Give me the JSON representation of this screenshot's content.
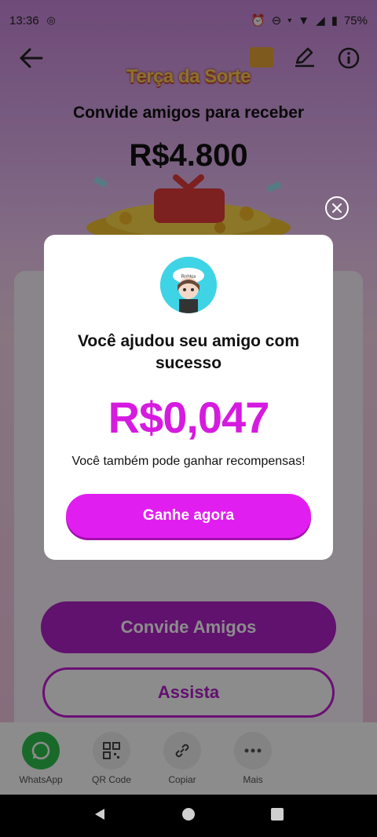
{
  "status_bar": {
    "time": "13:36",
    "battery": "75%"
  },
  "header": {
    "brand_title": "Terça da Sorte",
    "headline": "Convide amigos para receber",
    "big_amount": "R$4.800"
  },
  "main": {
    "invite_button_label": "Convide Amigos",
    "watch_button_label": "Assista"
  },
  "share_bar": {
    "items": [
      {
        "label": "WhatsApp",
        "icon": "whatsapp-icon"
      },
      {
        "label": "QR Code",
        "icon": "qr-code-icon"
      },
      {
        "label": "Copiar",
        "icon": "link-icon"
      },
      {
        "label": "Mais",
        "icon": "more-icon"
      }
    ]
  },
  "modal": {
    "title": "Você ajudou seu amigo com sucesso",
    "amount": "R$0,047",
    "subtitle": "Você também pode ganhar recompensas!",
    "button_label": "Ganhe agora",
    "avatar_badge": "Roblox"
  },
  "colors": {
    "accent": "#e11ef0",
    "amount": "#d61be0",
    "primary_button": "#b11fc8",
    "whatsapp": "#2fc24e"
  }
}
